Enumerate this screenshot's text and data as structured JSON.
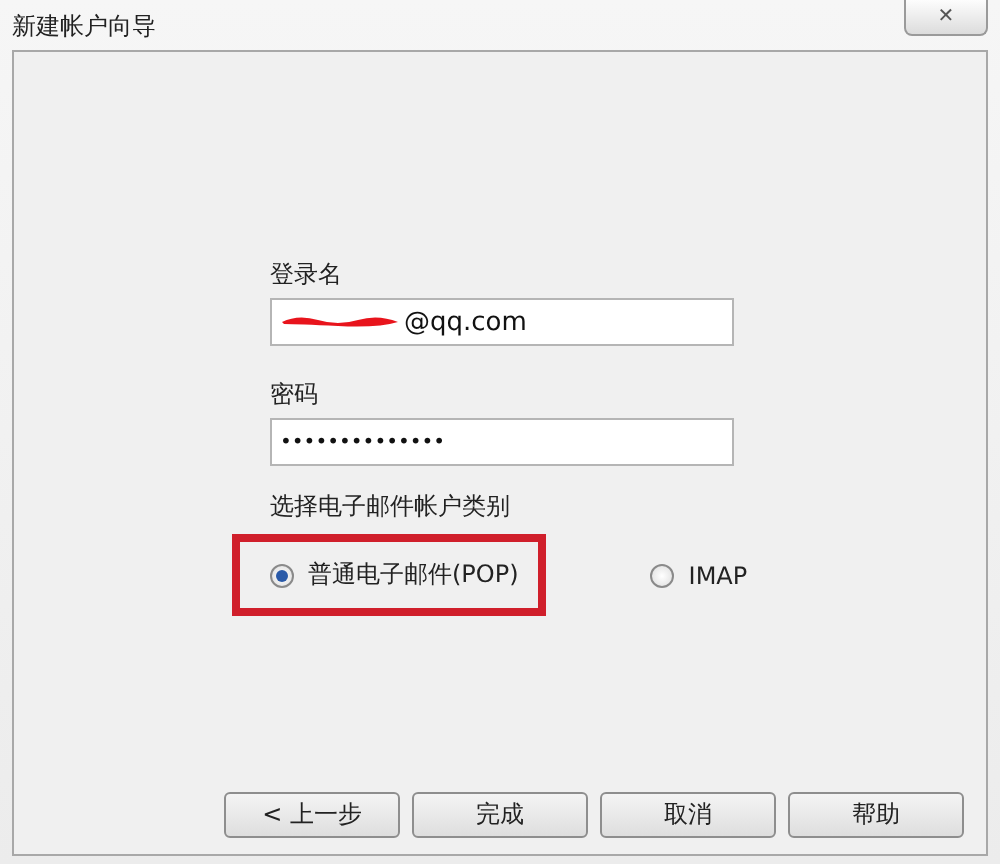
{
  "window": {
    "title": "新建帐户向导",
    "close": "✕"
  },
  "form": {
    "login_label": "登录名",
    "login_value": "@qq.com",
    "login_redacted": true,
    "password_label": "密码",
    "password_value": "••••••••••••••",
    "type_label": "选择电子邮件帐户类别",
    "account_types": [
      {
        "label": "普通电子邮件(POP)",
        "selected": true,
        "highlighted": true
      },
      {
        "label": "IMAP",
        "selected": false,
        "highlighted": false
      }
    ]
  },
  "buttons": [
    "< 上一步",
    "完成",
    "取消",
    "帮助"
  ]
}
